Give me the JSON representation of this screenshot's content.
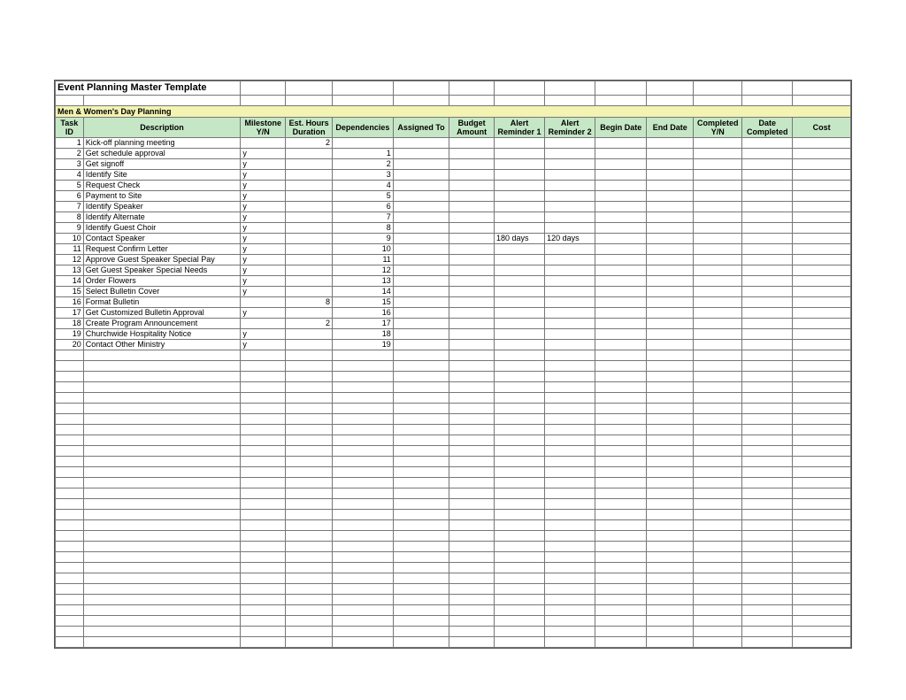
{
  "title": "Event Planning  Master Template",
  "subtitle": "Men & Women's Day Planning",
  "headers": {
    "id": "Task ID",
    "desc": "Description",
    "ms": "Milestone Y/N",
    "dur": "Est. Hours Duration",
    "dep": "Dependencies",
    "asg": "Assigned To",
    "bud": "Budget Amount",
    "r1": "Alert Reminder 1",
    "r2": "Alert Reminder 2",
    "bd": "Begin Date",
    "ed": "End Date",
    "cp": "Completed Y/N",
    "dc": "Date Completed",
    "cost": "Cost"
  },
  "rows": [
    {
      "id": "1",
      "desc": "Kick-off planning meeting",
      "ms": "",
      "dur": "2",
      "dep": "",
      "r1": "",
      "r2": ""
    },
    {
      "id": "2",
      "desc": "Get schedule approval",
      "ms": "y",
      "dur": "",
      "dep": "1",
      "r1": "",
      "r2": ""
    },
    {
      "id": "3",
      "desc": "Get signoff",
      "ms": "y",
      "dur": "",
      "dep": "2",
      "r1": "",
      "r2": ""
    },
    {
      "id": "4",
      "desc": "Identify Site",
      "ms": "y",
      "dur": "",
      "dep": "3",
      "r1": "",
      "r2": ""
    },
    {
      "id": "5",
      "desc": "Request Check",
      "ms": "y",
      "dur": "",
      "dep": "4",
      "r1": "",
      "r2": ""
    },
    {
      "id": "6",
      "desc": "Payment to Site",
      "ms": "y",
      "dur": "",
      "dep": "5",
      "r1": "",
      "r2": ""
    },
    {
      "id": "7",
      "desc": "Identify Speaker",
      "ms": "y",
      "dur": "",
      "dep": "6",
      "r1": "",
      "r2": ""
    },
    {
      "id": "8",
      "desc": "Identify Alternate",
      "ms": "y",
      "dur": "",
      "dep": "7",
      "r1": "",
      "r2": ""
    },
    {
      "id": "9",
      "desc": "Identify Guest Choir",
      "ms": "y",
      "dur": "",
      "dep": "8",
      "r1": "",
      "r2": ""
    },
    {
      "id": "10",
      "desc": "Contact Speaker",
      "ms": "y",
      "dur": "",
      "dep": "9",
      "r1": "180 days",
      "r2": "120 days"
    },
    {
      "id": "11",
      "desc": "Request Confirm Letter",
      "ms": "y",
      "dur": "",
      "dep": "10",
      "r1": "",
      "r2": ""
    },
    {
      "id": "12",
      "desc": "Approve Guest Speaker Special Pay",
      "ms": "y",
      "dur": "",
      "dep": "11",
      "r1": "",
      "r2": ""
    },
    {
      "id": "13",
      "desc": "Get Guest Speaker Special Needs",
      "ms": "y",
      "dur": "",
      "dep": "12",
      "r1": "",
      "r2": ""
    },
    {
      "id": "14",
      "desc": "Order Flowers",
      "ms": "y",
      "dur": "",
      "dep": "13",
      "r1": "",
      "r2": ""
    },
    {
      "id": "15",
      "desc": "Select Bulletin Cover",
      "ms": "y",
      "dur": "",
      "dep": "14",
      "r1": "",
      "r2": ""
    },
    {
      "id": "16",
      "desc": "Format Bulletin",
      "ms": "",
      "dur": "8",
      "dep": "15",
      "r1": "",
      "r2": ""
    },
    {
      "id": "17",
      "desc": "Get Customized Bulletin Approval",
      "ms": "y",
      "dur": "",
      "dep": "16",
      "r1": "",
      "r2": ""
    },
    {
      "id": "18",
      "desc": "Create Program Announcement",
      "ms": "",
      "dur": "2",
      "dep": "17",
      "r1": "",
      "r2": ""
    },
    {
      "id": "19",
      "desc": "Churchwide Hospitality Notice",
      "ms": "y",
      "dur": "",
      "dep": "18",
      "r1": "",
      "r2": ""
    },
    {
      "id": "20",
      "desc": "Contact Other Ministry",
      "ms": "y",
      "dur": "",
      "dep": "19",
      "r1": "",
      "r2": ""
    }
  ],
  "empty_rows": 28
}
